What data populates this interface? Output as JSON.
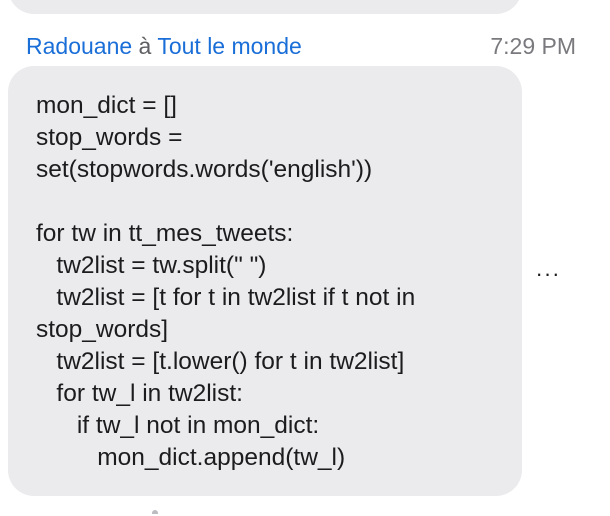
{
  "message": {
    "sender": "Radouane",
    "separator": "à",
    "recipient": "Tout le monde",
    "time": "7:29 PM",
    "code_lines": [
      "mon_dict = []",
      "stop_words =",
      "set(stopwords.words('english'))",
      "",
      "for tw in tt_mes_tweets:",
      "   tw2list = tw.split(\" \")",
      "   tw2list = [t for t in tw2list if t not in",
      "stop_words]",
      "   tw2list = [t.lower() for t in tw2list]",
      "   for tw_l in tw2list:",
      "      if tw_l not in mon_dict:",
      "         mon_dict.append(tw_l)"
    ]
  },
  "actions": {
    "more_label": "···"
  }
}
